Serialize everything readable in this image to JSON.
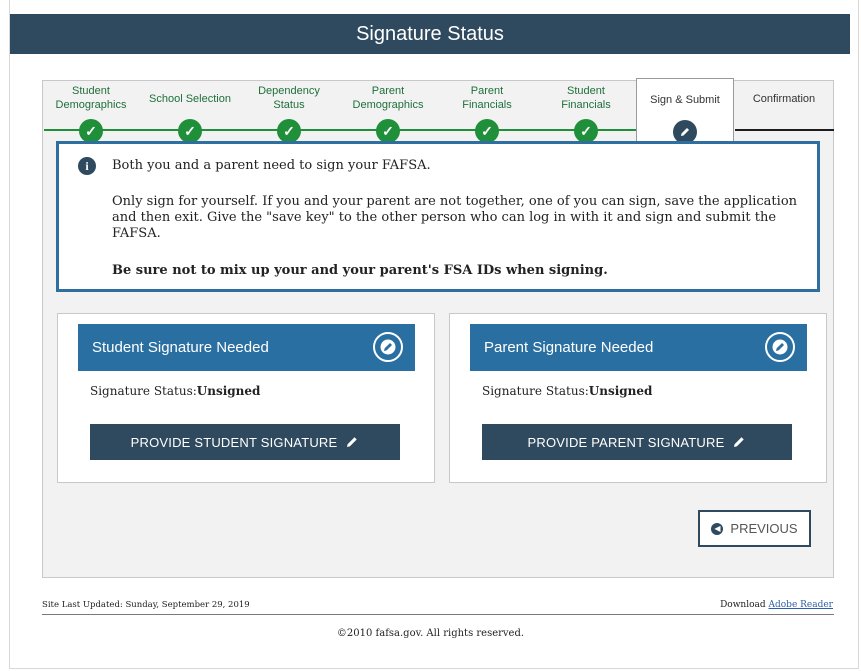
{
  "header": {
    "title": "Signature Status"
  },
  "progress": {
    "steps": [
      {
        "label": "Student\nDemographics",
        "status": "complete"
      },
      {
        "label": "School Selection",
        "status": "complete"
      },
      {
        "label": "Dependency\nStatus",
        "status": "complete"
      },
      {
        "label": "Parent\nDemographics",
        "status": "complete"
      },
      {
        "label": "Parent\nFinancials",
        "status": "complete"
      },
      {
        "label": "Student\nFinancials",
        "status": "complete"
      },
      {
        "label": "Sign & Submit",
        "status": "active"
      },
      {
        "label": "Confirmation",
        "status": "pending"
      }
    ],
    "check_icon": "✓",
    "colors": {
      "complete": "#1f8f3a",
      "active": "#2f4a5f"
    }
  },
  "info": {
    "icon": "i",
    "line1": "Both you and a parent need to sign your FAFSA.",
    "para": "Only sign for yourself. If you and your parent are not together, one of you can sign, save the application and then exit. Give the \"save key\" to the other person who can log in with it and sign and submit the FAFSA.",
    "warning": "Be sure not to mix up your and your parent's FSA IDs when signing."
  },
  "student_card": {
    "title": "Student Signature Needed",
    "status_label": "Signature Status:",
    "status_value": "Unsigned",
    "button_label": "PROVIDE STUDENT SIGNATURE"
  },
  "parent_card": {
    "title": "Parent Signature Needed",
    "status_label": "Signature Status:",
    "status_value": "Unsigned",
    "button_label": "PROVIDE PARENT SIGNATURE"
  },
  "nav": {
    "previous_label": "PREVIOUS"
  },
  "footer": {
    "last_updated": "Site Last Updated: Sunday, September 29, 2019",
    "download_prefix": "Download ",
    "download_link": "Adobe Reader",
    "copyright": "©2010 fafsa.gov. All rights reserved."
  }
}
